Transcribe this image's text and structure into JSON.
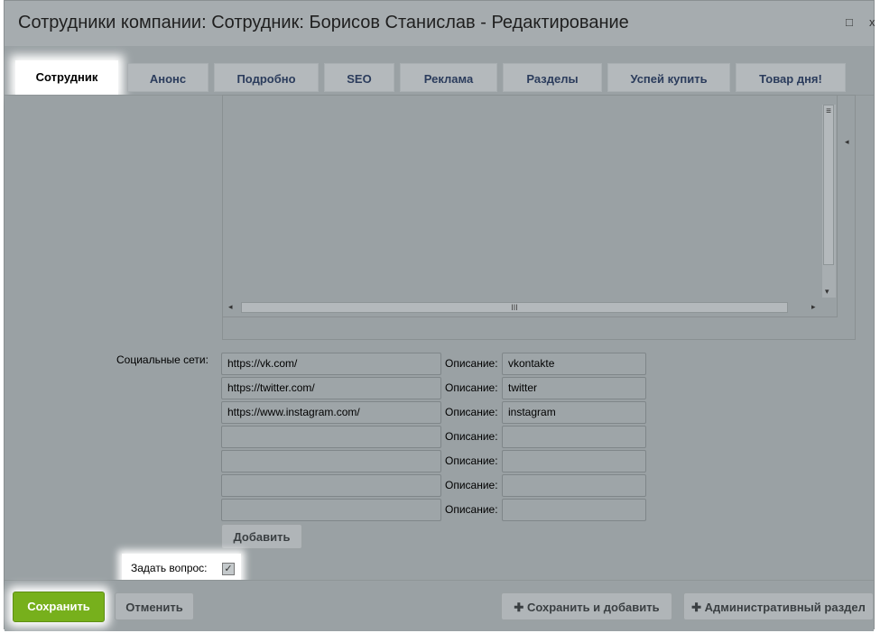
{
  "window": {
    "title": "Сотрудники компании: Сотрудник: Борисов Станислав - Редактирование",
    "maximize_glyph": "□",
    "close_glyph": "x"
  },
  "tabs": [
    {
      "label": "Сотрудник",
      "active": true
    },
    {
      "label": "Анонс",
      "active": false
    },
    {
      "label": "Подробно",
      "active": false
    },
    {
      "label": "SEO",
      "active": false
    },
    {
      "label": "Реклама",
      "active": false
    },
    {
      "label": "Разделы",
      "active": false
    },
    {
      "label": "Успей купить",
      "active": false
    },
    {
      "label": "Товар дня!",
      "active": false
    }
  ],
  "editor": {
    "scroll_grip": "≡",
    "hscroll_grip": "III",
    "arrow_left": "◂",
    "arrow_right": "▸",
    "arrow_down": "▾",
    "collapse_arrow": "◂"
  },
  "social": {
    "label": "Социальные сети:",
    "desc_label": "Описание:",
    "rows": [
      {
        "url": "https://vk.com/",
        "desc": "vkontakte"
      },
      {
        "url": "https://twitter.com/",
        "desc": "twitter"
      },
      {
        "url": "https://www.instagram.com/",
        "desc": "instagram"
      },
      {
        "url": "",
        "desc": ""
      },
      {
        "url": "",
        "desc": ""
      },
      {
        "url": "",
        "desc": ""
      },
      {
        "url": "",
        "desc": ""
      }
    ],
    "add_button": "Добавить"
  },
  "ask_question": {
    "label": "Задать вопрос:",
    "checked": true,
    "check_glyph": "✓"
  },
  "footer": {
    "save": "Сохранить",
    "cancel": "Отменить",
    "save_and_add": "Сохранить и добавить",
    "admin_section": "Административный раздел",
    "plus_glyph": "✚"
  }
}
